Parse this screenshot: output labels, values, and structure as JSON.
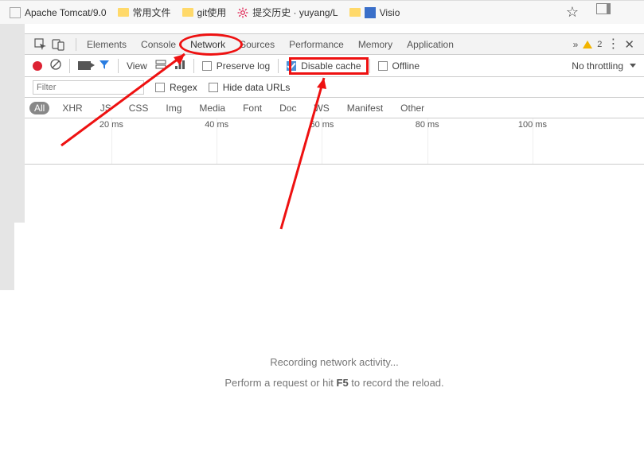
{
  "bookmarks": {
    "items": [
      {
        "label": "Apache Tomcat/9.0"
      },
      {
        "label": "常用文件"
      },
      {
        "label": "git使用"
      },
      {
        "label": "提交历史 · yuyang/L"
      },
      {
        "label": "Visio"
      }
    ]
  },
  "devtools": {
    "tabs": [
      "Elements",
      "Console",
      "Network",
      "Sources",
      "Performance",
      "Memory",
      "Application"
    ],
    "active_tab": "Network",
    "warnings": "2",
    "toolbar": {
      "view_label": "View",
      "preserve_log": "Preserve log",
      "disable_cache": "Disable cache",
      "offline": "Offline",
      "throttling": "No throttling"
    },
    "filter": {
      "placeholder": "Filter",
      "regex": "Regex",
      "hide_data_urls": "Hide data URLs"
    },
    "cats": [
      "All",
      "XHR",
      "JS",
      "CSS",
      "Img",
      "Media",
      "Font",
      "Doc",
      "WS",
      "Manifest",
      "Other"
    ],
    "timeline": [
      "20 ms",
      "40 ms",
      "60 ms",
      "80 ms",
      "100 ms"
    ],
    "empty": {
      "line1": "Recording network activity...",
      "line2_a": "Perform a request or hit ",
      "line2_b": "F5",
      "line2_c": " to record the reload."
    }
  }
}
